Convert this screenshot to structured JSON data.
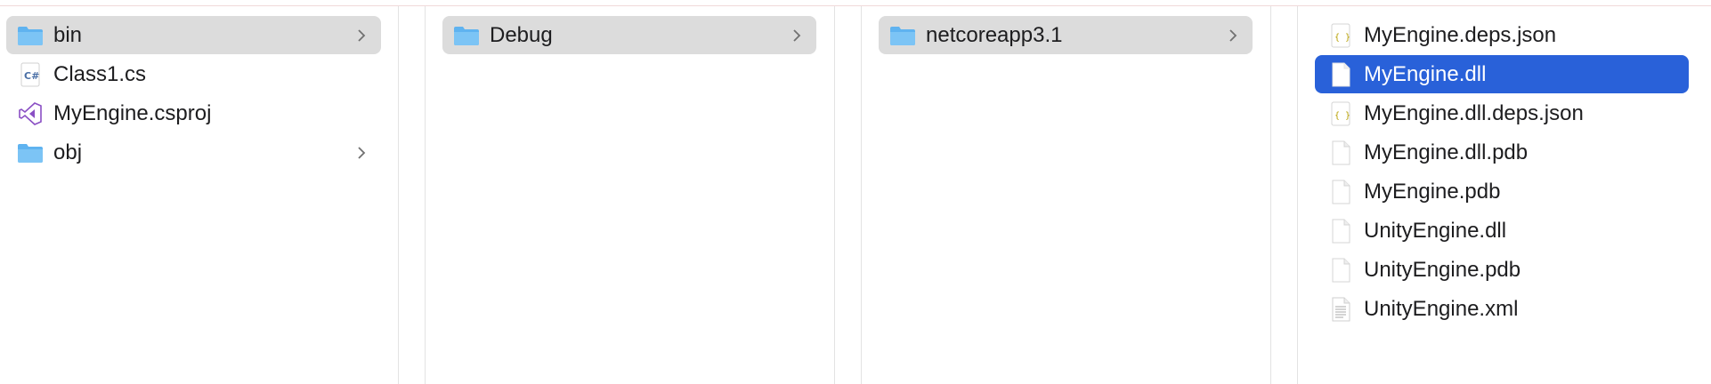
{
  "columns": [
    {
      "items": [
        {
          "label": "bin",
          "icon": "folder-icon",
          "chevron": true,
          "selected": "gray"
        },
        {
          "label": "Class1.cs",
          "icon": "csharp-file-icon",
          "chevron": false,
          "selected": "none"
        },
        {
          "label": "MyEngine.csproj",
          "icon": "visual-studio-icon",
          "chevron": false,
          "selected": "none"
        },
        {
          "label": "obj",
          "icon": "folder-icon",
          "chevron": true,
          "selected": "none"
        }
      ]
    },
    {
      "items": [
        {
          "label": "Debug",
          "icon": "folder-icon",
          "chevron": true,
          "selected": "gray"
        }
      ]
    },
    {
      "items": [
        {
          "label": "netcoreapp3.1",
          "icon": "folder-icon",
          "chevron": true,
          "selected": "gray"
        }
      ]
    },
    {
      "items": [
        {
          "label": "MyEngine.deps.json",
          "icon": "json-file-icon",
          "chevron": false,
          "selected": "none"
        },
        {
          "label": "MyEngine.dll",
          "icon": "document-icon",
          "chevron": false,
          "selected": "blue"
        },
        {
          "label": "MyEngine.dll.deps.json",
          "icon": "json-file-icon",
          "chevron": false,
          "selected": "none"
        },
        {
          "label": "MyEngine.dll.pdb",
          "icon": "document-icon",
          "chevron": false,
          "selected": "none"
        },
        {
          "label": "MyEngine.pdb",
          "icon": "document-icon",
          "chevron": false,
          "selected": "none"
        },
        {
          "label": "UnityEngine.dll",
          "icon": "document-icon",
          "chevron": false,
          "selected": "none"
        },
        {
          "label": "UnityEngine.pdb",
          "icon": "document-icon",
          "chevron": false,
          "selected": "none"
        },
        {
          "label": "UnityEngine.xml",
          "icon": "text-document-icon",
          "chevron": false,
          "selected": "none"
        }
      ]
    }
  ],
  "colors": {
    "selection_blue": "#2961d9",
    "selection_gray": "#dcdcdc",
    "folder_blue": "#5fb3f0"
  }
}
